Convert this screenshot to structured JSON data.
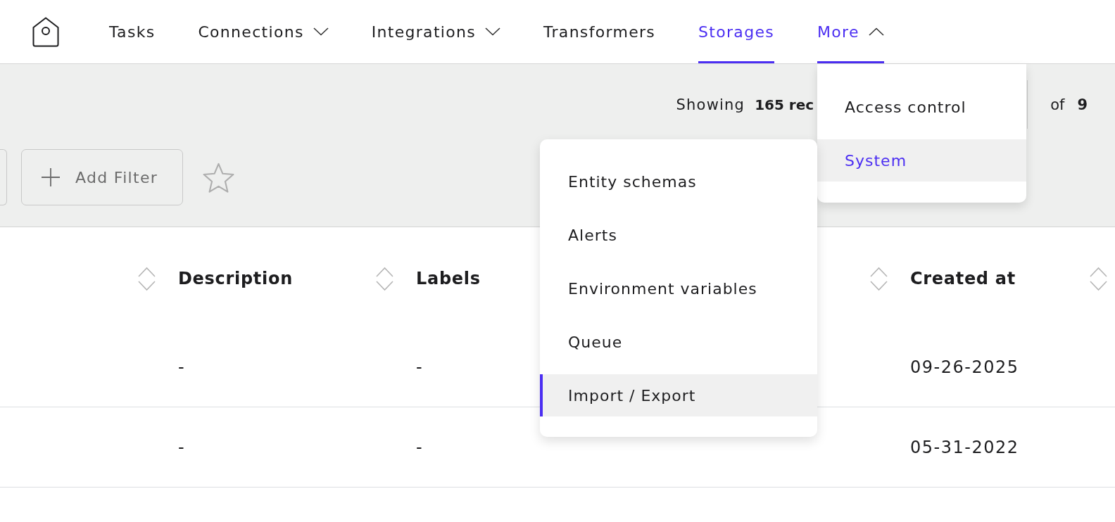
{
  "nav": {
    "items": [
      {
        "label": "Tasks",
        "kind": "link",
        "selected": false
      },
      {
        "label": "Connections",
        "kind": "menu",
        "selected": false,
        "expanded": false
      },
      {
        "label": "Integrations",
        "kind": "menu",
        "selected": false,
        "expanded": false
      },
      {
        "label": "Transformers",
        "kind": "link",
        "selected": false
      },
      {
        "label": "Storages",
        "kind": "link",
        "selected": true
      },
      {
        "label": "More",
        "kind": "menu",
        "selected": true,
        "expanded": true,
        "menu": [
          {
            "label": "Access control",
            "selected": false
          },
          {
            "label": "System",
            "selected": true,
            "expanded": true,
            "children": [
              {
                "label": "Entity schemas",
                "selected": false
              },
              {
                "label": "Alerts",
                "selected": false
              },
              {
                "label": "Environment variables",
                "selected": false
              },
              {
                "label": "Queue",
                "selected": false
              },
              {
                "label": "Import / Export",
                "selected": true
              }
            ]
          }
        ]
      }
    ]
  },
  "toolbar": {
    "records": {
      "label": "Showing",
      "count": "165 rec"
    },
    "pagination": {
      "label": "of",
      "total": "9"
    },
    "add_filter": {
      "label": "Add Filter"
    },
    "favorite": {
      "starred": false
    }
  },
  "table": {
    "columns": [
      {
        "label": "Description"
      },
      {
        "label": "Labels"
      },
      {
        "label": "Created at"
      }
    ],
    "rows": [
      {
        "description": "-",
        "labels": "-",
        "created_at": "09-26-2025"
      },
      {
        "description": "-",
        "labels": "-",
        "created_at": "05-31-2022"
      }
    ]
  }
}
